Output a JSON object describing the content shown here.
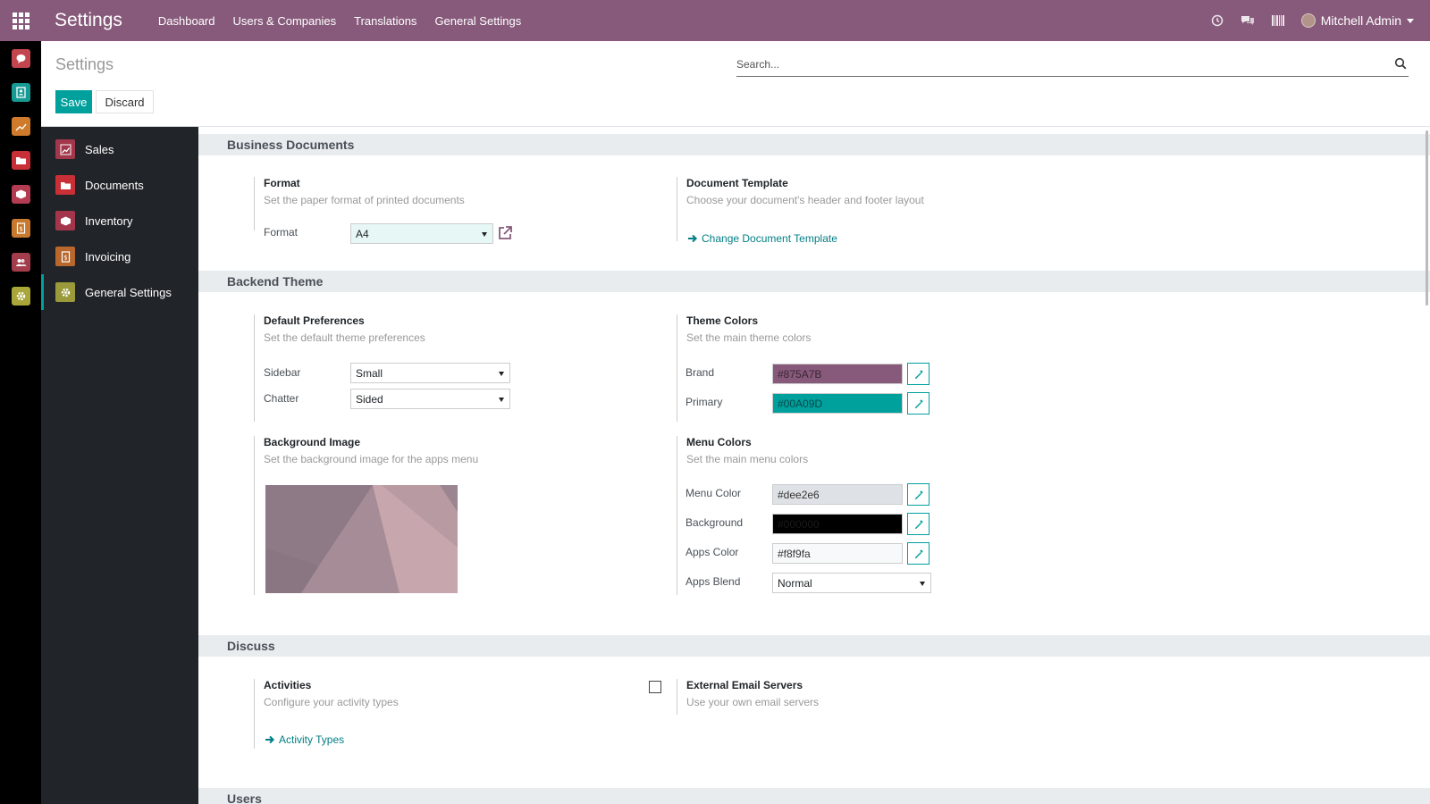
{
  "topbar": {
    "app_title": "Settings",
    "menu": [
      "Dashboard",
      "Users & Companies",
      "Translations",
      "General Settings"
    ],
    "icons": [
      "clock-icon",
      "chat-icon",
      "barcode-icon"
    ],
    "user_name": "Mitchell Admin",
    "color": "#875A7B"
  },
  "rail": {
    "items": [
      {
        "name": "discuss",
        "color": "#c3464e"
      },
      {
        "name": "contacts",
        "color": "#169a93"
      },
      {
        "name": "sales",
        "color": "#d07a2b"
      },
      {
        "name": "documents",
        "color": "#c82f36"
      },
      {
        "name": "inventory",
        "color": "#b33c52"
      },
      {
        "name": "invoicing",
        "color": "#c6792f"
      },
      {
        "name": "employees",
        "color": "#a33d4b"
      },
      {
        "name": "settings",
        "color": "#a9a73a"
      }
    ]
  },
  "control_panel": {
    "title": "Settings",
    "save_label": "Save",
    "discard_label": "Discard",
    "search_placeholder": "Search..."
  },
  "settings_nav": {
    "items": [
      {
        "label": "Sales",
        "color": "#a2364a",
        "active": false
      },
      {
        "label": "Documents",
        "color": "#c82f36",
        "active": false
      },
      {
        "label": "Inventory",
        "color": "#a3364a",
        "active": false
      },
      {
        "label": "Invoicing",
        "color": "#b8672d",
        "active": false
      },
      {
        "label": "General Settings",
        "color": "#9a9a3a",
        "active": true
      }
    ]
  },
  "sections": {
    "business_documents": {
      "header": "Business Documents",
      "format": {
        "title": "Format",
        "desc": "Set the paper format of printed documents",
        "label": "Format",
        "value": "A4"
      },
      "template": {
        "title": "Document Template",
        "desc": "Choose your document's header and footer layout",
        "link": "Change Document Template"
      }
    },
    "backend_theme": {
      "header": "Backend Theme",
      "default_prefs": {
        "title": "Default Preferences",
        "desc": "Set the default theme preferences",
        "sidebar_label": "Sidebar",
        "sidebar_value": "Small",
        "chatter_label": "Chatter",
        "chatter_value": "Sided"
      },
      "theme_colors": {
        "title": "Theme Colors",
        "desc": "Set the main theme colors",
        "brand_label": "Brand",
        "brand_value": "#875A7B",
        "primary_label": "Primary",
        "primary_value": "#00A09D"
      },
      "background_image": {
        "title": "Background Image",
        "desc": "Set the background image for the apps menu"
      },
      "menu_colors": {
        "title": "Menu Colors",
        "desc": "Set the main menu colors",
        "menu_color_label": "Menu Color",
        "menu_color_value": "#dee2e6",
        "background_label": "Background",
        "background_value": "#000000",
        "apps_color_label": "Apps Color",
        "apps_color_value": "#f8f9fa",
        "apps_blend_label": "Apps Blend",
        "apps_blend_value": "Normal"
      }
    },
    "discuss": {
      "header": "Discuss",
      "activities": {
        "title": "Activities",
        "desc": "Configure your activity types",
        "link": "Activity Types"
      },
      "email_servers": {
        "title": "External Email Servers",
        "desc": "Use your own email servers",
        "checked": false
      }
    },
    "users": {
      "header": "Users"
    }
  }
}
